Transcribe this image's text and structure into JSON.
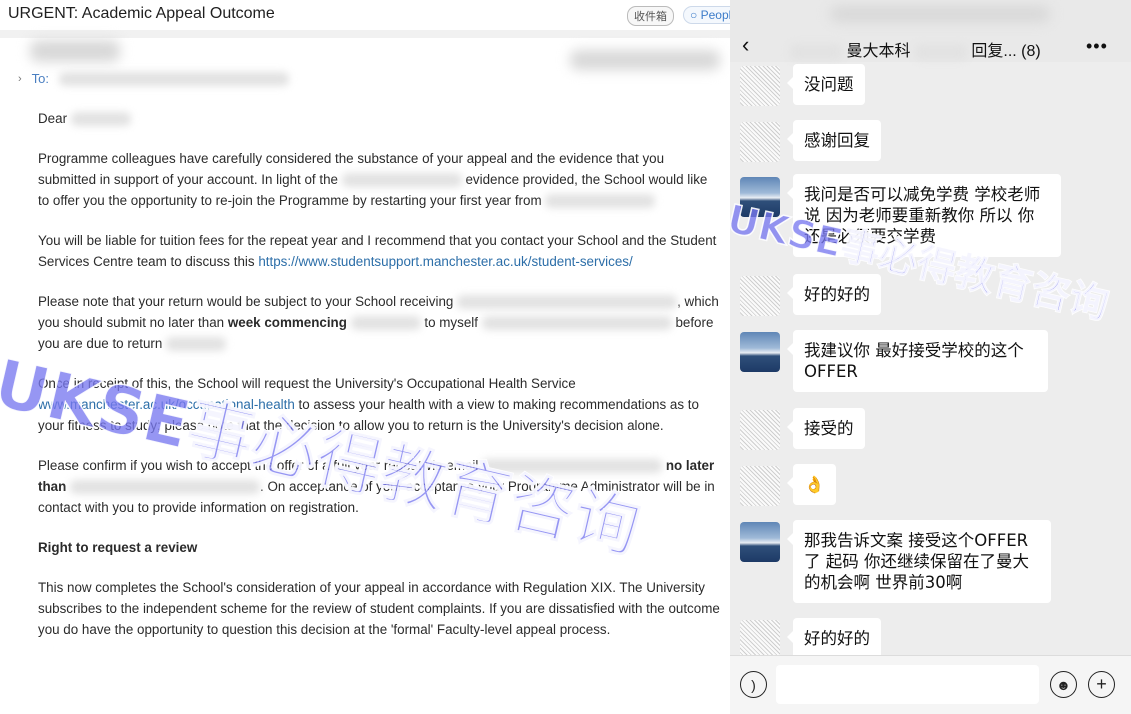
{
  "email": {
    "subject": "URGENT: Academic Appeal Outcome",
    "tags": {
      "inbox": "收件箱",
      "people": "Peopl"
    },
    "to_label": "To:",
    "greeting": "Dear",
    "p1": "Programme colleagues have carefully considered the substance of your appeal and the evidence that you submitted in support of your account. In light of the",
    "p1b": "evidence provided, the School would like to offer you the opportunity to re-join the Programme by restarting your first year from",
    "p2": "You will be liable for tuition fees for the repeat year and I recommend that you contact your School and the Student Services Centre team to discuss this",
    "p2_link": "https://www.studentsupport.manchester.ac.uk/student-services/",
    "p3a": "Please note that your return would be subject to your School receiving",
    "p3b": ", which you should submit no later than",
    "p3_bold": "week commencing",
    "p3c": "to myself",
    "p3d": "before you are due to return",
    "p4a": "Once in receipt of this, the School will request the University's Occupational Health Service",
    "p4_link": "www.manchester.ac.uk/occupational-health",
    "p4b": "to assess your health with a view to making recommendations as to your fitness to study; please note that the decision to allow you to return is the University's decision alone.",
    "p5a": "Please confirm if you wish to accept the offer of a full year repeat via email",
    "p5_bold": "no later than",
    "p5b": ". On acceptance of your acceptance your Programme Administrator will be in contact with you to provide information on registration.",
    "h_review": "Right to request a review",
    "p6": "This now completes the School's consideration of your appeal in accordance with Regulation XIX. The University subscribes to the independent scheme for the review of student complaints. If you are dissatisfied with the outcome you do have the opportunity to question this decision at the 'formal' Faculty-level appeal process."
  },
  "chat": {
    "title": "曼大本科",
    "title_suffix": "回复... (8)",
    "back_icon": "‹",
    "more_icon": "•••",
    "messages": [
      {
        "avatar": "hatch",
        "text": "没问题"
      },
      {
        "avatar": "hatch",
        "text": "感谢回复"
      },
      {
        "avatar": "sea",
        "text": "我问是否可以减免学费 学校老师说 因为老师要重新教你 所以 你还是必须要交学费"
      },
      {
        "avatar": "hatch",
        "text": "好的好的"
      },
      {
        "avatar": "sea",
        "text": "我建议你 最好接受学校的这个OFFER"
      },
      {
        "avatar": "hatch",
        "text": "接受的"
      },
      {
        "avatar": "hatch",
        "text": "👌"
      },
      {
        "avatar": "sea",
        "text": "那我告诉文案 接受这个OFFER了 起码 你还继续保留在了曼大的机会啊 世界前30啊"
      },
      {
        "avatar": "hatch",
        "text": "好的好的"
      }
    ]
  },
  "watermark": "UKSE事必得教育咨询"
}
